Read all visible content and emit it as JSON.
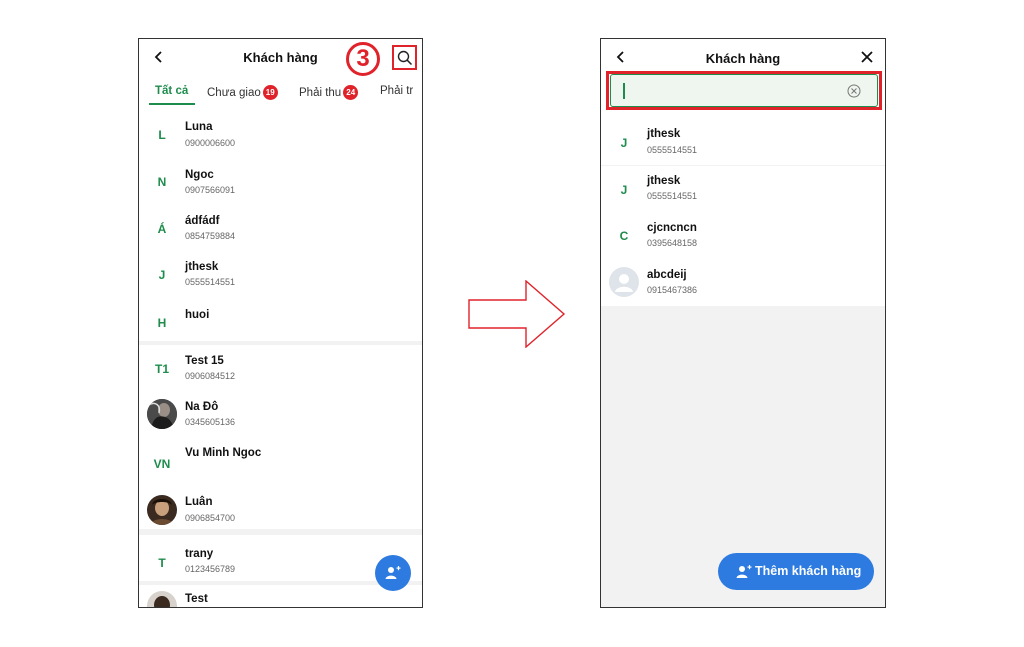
{
  "left_screen": {
    "title": "Khách hàng",
    "step_marker": "3",
    "tabs": [
      {
        "label": "Tất cả",
        "badge": ""
      },
      {
        "label": "Chưa giao",
        "badge": "19"
      },
      {
        "label": "Phải thu",
        "badge": "24"
      },
      {
        "label": "Phải tr",
        "badge": ""
      }
    ],
    "customers": [
      {
        "initial": "L",
        "name": "Luna",
        "phone": "0900006600"
      },
      {
        "initial": "N",
        "name": "Ngoc",
        "phone": "0907566091"
      },
      {
        "initial": "Á",
        "name": "ádfádf",
        "phone": "0854759884"
      },
      {
        "initial": "J",
        "name": "jthesk",
        "phone": "0555514551"
      },
      {
        "initial": "H",
        "name": "huoi",
        "phone": ""
      },
      {
        "initial": "T1",
        "name": "Test 15",
        "phone": "0906084512"
      },
      {
        "initial": "",
        "name": "Na Đô",
        "phone": "0345605136"
      },
      {
        "initial": "VN",
        "name": "Vu Minh Ngoc",
        "phone": ""
      },
      {
        "initial": "",
        "name": "Luân",
        "phone": "0906854700"
      },
      {
        "initial": "T",
        "name": "trany",
        "phone": "0123456789"
      },
      {
        "initial": "",
        "name": "Test",
        "phone": ""
      }
    ]
  },
  "right_screen": {
    "title": "Khách hàng",
    "search": {
      "value": "",
      "placeholder": ""
    },
    "results": [
      {
        "initial": "J",
        "name": "jthesk",
        "phone": "0555514551"
      },
      {
        "initial": "J",
        "name": "jthesk",
        "phone": "0555514551"
      },
      {
        "initial": "C",
        "name": "cjcncncn",
        "phone": "0395648158"
      },
      {
        "initial": "",
        "name": "abcdeij",
        "phone": "0915467386"
      }
    ],
    "add_button_label": "Thêm khách hàng"
  },
  "colors": {
    "accent_green": "#1e8c4c",
    "highlight_red": "#e0232a",
    "button_blue": "#2d7be0"
  },
  "icons": [
    "back-icon",
    "search-icon",
    "close-icon",
    "clear-icon",
    "add-person-icon",
    "user-placeholder-icon",
    "right-arrow-icon"
  ]
}
